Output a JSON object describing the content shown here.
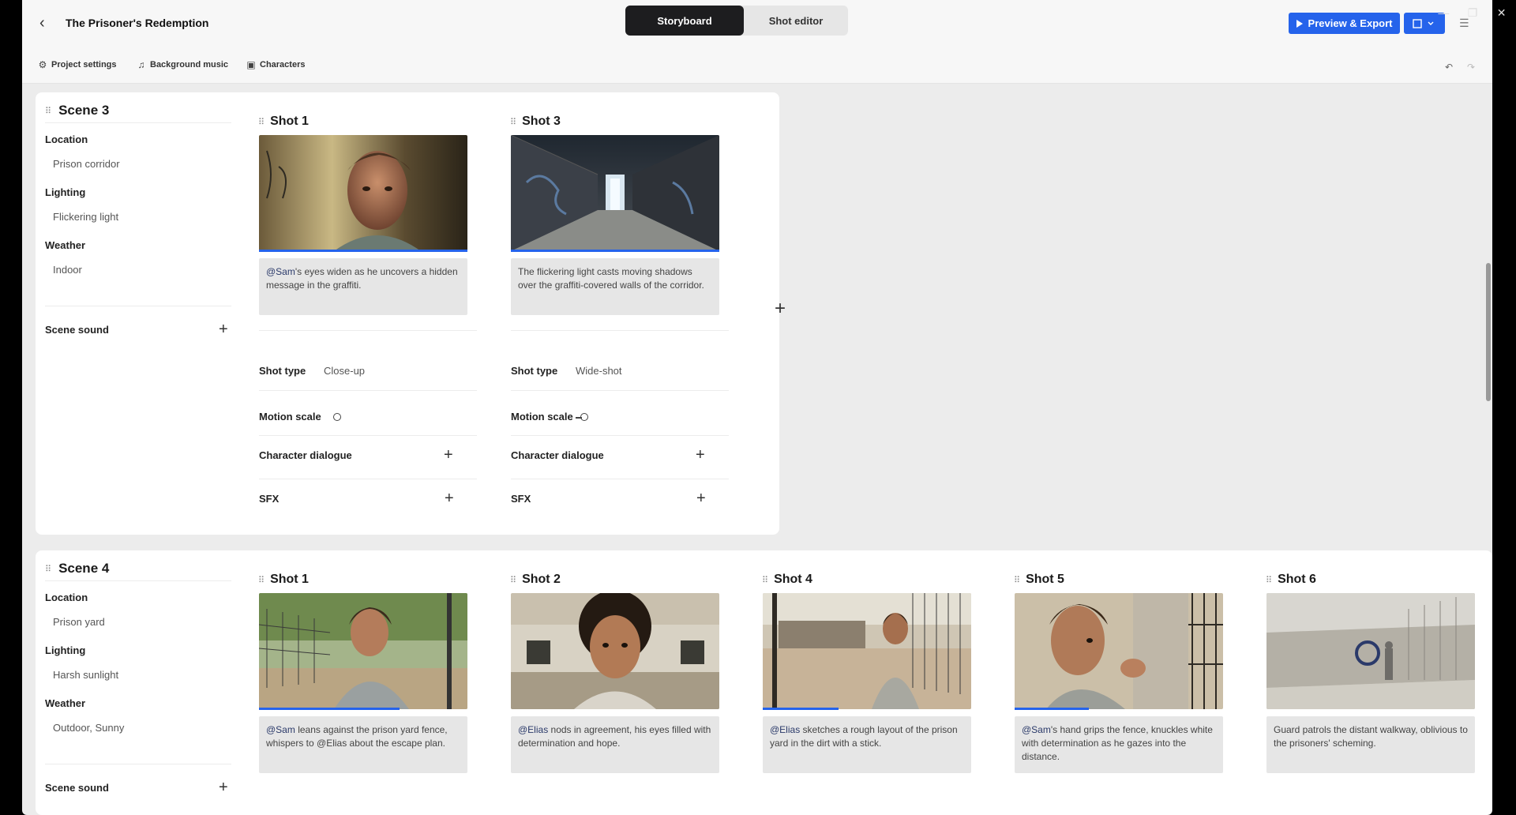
{
  "window": {
    "minimize": "—",
    "maximize": "❐",
    "close": "✕"
  },
  "header": {
    "title": "The Prisoner's Redemption",
    "tabs": [
      {
        "label": "Storyboard",
        "active": true
      },
      {
        "label": "Shot editor",
        "active": false
      }
    ],
    "export_label": "Preview & Export"
  },
  "toolbar": {
    "project_settings": "Project settings",
    "background_music": "Background music",
    "characters": "Characters"
  },
  "scenes": [
    {
      "title": "Scene 3",
      "location_label": "Location",
      "location": "Prison corridor",
      "lighting_label": "Lighting",
      "lighting": "Flickering light",
      "weather_label": "Weather",
      "weather": "Indoor",
      "sound_label": "Scene sound",
      "shots": [
        {
          "title": "Shot 1",
          "mention": "@Sam",
          "text": "'s eyes widen as he uncovers a hidden message in the graffiti.",
          "shot_type_label": "Shot type",
          "shot_type": "Close-up",
          "motion_label": "Motion scale",
          "motion": 0.0,
          "dialogue_label": "Character dialogue",
          "sfx_label": "SFX"
        },
        {
          "title": "Shot 3",
          "mention": "",
          "text": "The flickering light casts moving shadows over the graffiti-covered walls of the corridor.",
          "shot_type_label": "Shot type",
          "shot_type": "Wide-shot",
          "motion_label": "Motion scale",
          "motion": 0.1,
          "dialogue_label": "Character dialogue",
          "sfx_label": "SFX"
        }
      ]
    },
    {
      "title": "Scene 4",
      "location_label": "Location",
      "location": "Prison yard",
      "lighting_label": "Lighting",
      "lighting": "Harsh sunlight",
      "weather_label": "Weather",
      "weather": "Outdoor, Sunny",
      "sound_label": "Scene sound",
      "shots": [
        {
          "title": "Shot 1",
          "mention": "@Sam",
          "text": " leans against the prison yard fence, whispers to @Elias about the escape plan."
        },
        {
          "title": "Shot 2",
          "mention": "@Elias",
          "text": " nods in agreement, his eyes filled with determination and hope."
        },
        {
          "title": "Shot 4",
          "mention": "@Elias",
          "text": " sketches a rough layout of the prison yard in the dirt with a stick."
        },
        {
          "title": "Shot 5",
          "mention": "@Sam",
          "text": "'s hand grips the fence, knuckles white with determination as he gazes into the distance."
        },
        {
          "title": "Shot 6",
          "mention": "",
          "text": "Guard patrols the distant walkway, oblivious to the prisoners' scheming."
        }
      ]
    }
  ],
  "colors": {
    "accent": "#2563eb",
    "dark": "#1d1d1f",
    "mention": "#2b3a6a"
  }
}
